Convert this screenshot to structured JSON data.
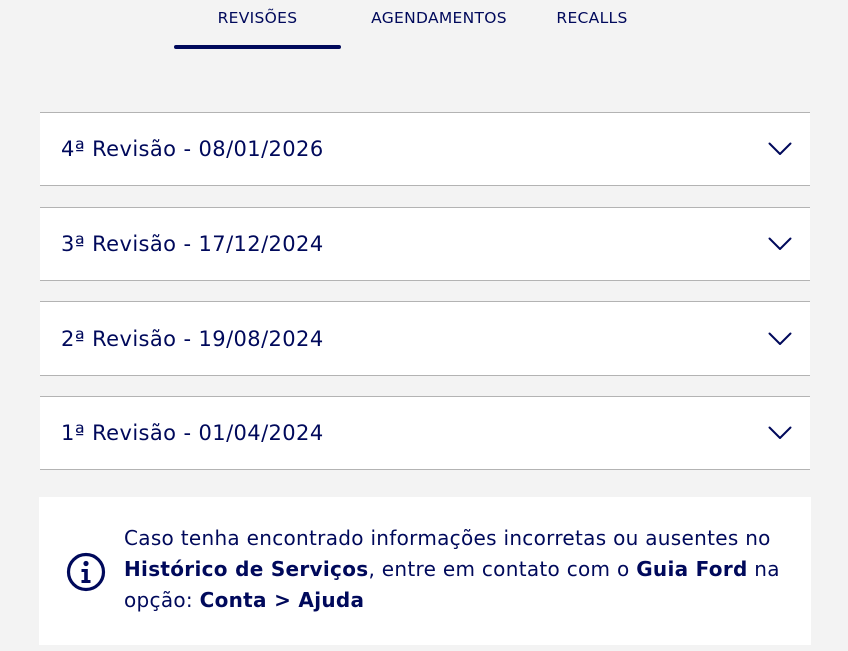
{
  "tabs": [
    {
      "label": "REVISÕES",
      "active": true
    },
    {
      "label": "AGENDAMENTOS",
      "active": false
    },
    {
      "label": "RECALLS",
      "active": false
    }
  ],
  "revisions": [
    {
      "title": "4ª Revisão - 08/01/2026"
    },
    {
      "title": "3ª Revisão - 17/12/2024"
    },
    {
      "title": "2ª Revisão - 19/08/2024"
    },
    {
      "title": "1ª Revisão - 01/04/2024"
    }
  ],
  "notice": {
    "icon": "info-icon",
    "part1": "Caso tenha encontrado informações incorretas ou ausentes no ",
    "bold1": "Histórico de Serviços",
    "part2": ", entre em contato com o ",
    "bold2": "Guia Ford",
    "part3": " na opção: ",
    "bold3": "Conta > Ajuda"
  },
  "colors": {
    "brand": "#00095b",
    "background": "#f3f3f3",
    "card": "#ffffff",
    "divider": "#b3b3b3"
  }
}
